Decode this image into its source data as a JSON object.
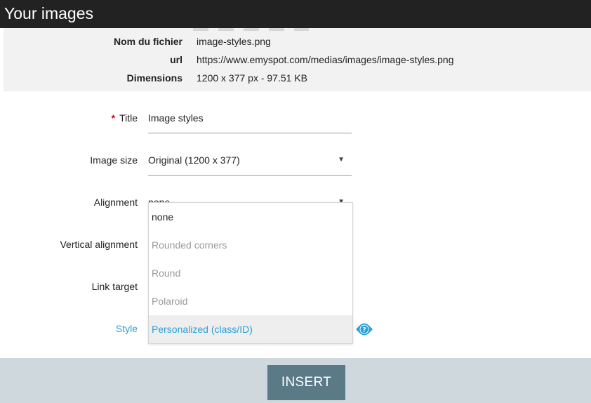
{
  "window": {
    "title": "Your images"
  },
  "file_info": {
    "rows": [
      {
        "key": "Nom du fichier",
        "value": "image-styles.png"
      },
      {
        "key": "url",
        "value": "https://www.emyspot.com/medias/images/image-styles.png"
      },
      {
        "key": "Dimensions",
        "value": "1200 x 377 px - 97.51 KB"
      }
    ]
  },
  "form": {
    "required_mark": "*",
    "title": {
      "label": "Title",
      "value": "Image styles"
    },
    "image_size": {
      "label": "Image size",
      "value": "Original (1200 x 377)"
    },
    "alignment": {
      "label": "Alignment",
      "value": "none"
    },
    "vertical_alignment": {
      "label": "Vertical alignment"
    },
    "link_target": {
      "label": "Link target"
    },
    "style": {
      "label": "Style"
    }
  },
  "style_dropdown": {
    "options": [
      "none",
      "Rounded corners",
      "Round",
      "Polaroid",
      "Personalized (class/ID)"
    ],
    "highlighted": "Personalized (class/ID)"
  },
  "icons": {
    "help": "help-question-icon",
    "caret": "caret-down-icon"
  },
  "colors": {
    "titlebar": "#222222",
    "accent": "#2a9fd8",
    "required": "#d0021b",
    "button": "#5a7a88",
    "footer": "#cfd8dc"
  },
  "footer": {
    "insert_label": "INSERT"
  }
}
